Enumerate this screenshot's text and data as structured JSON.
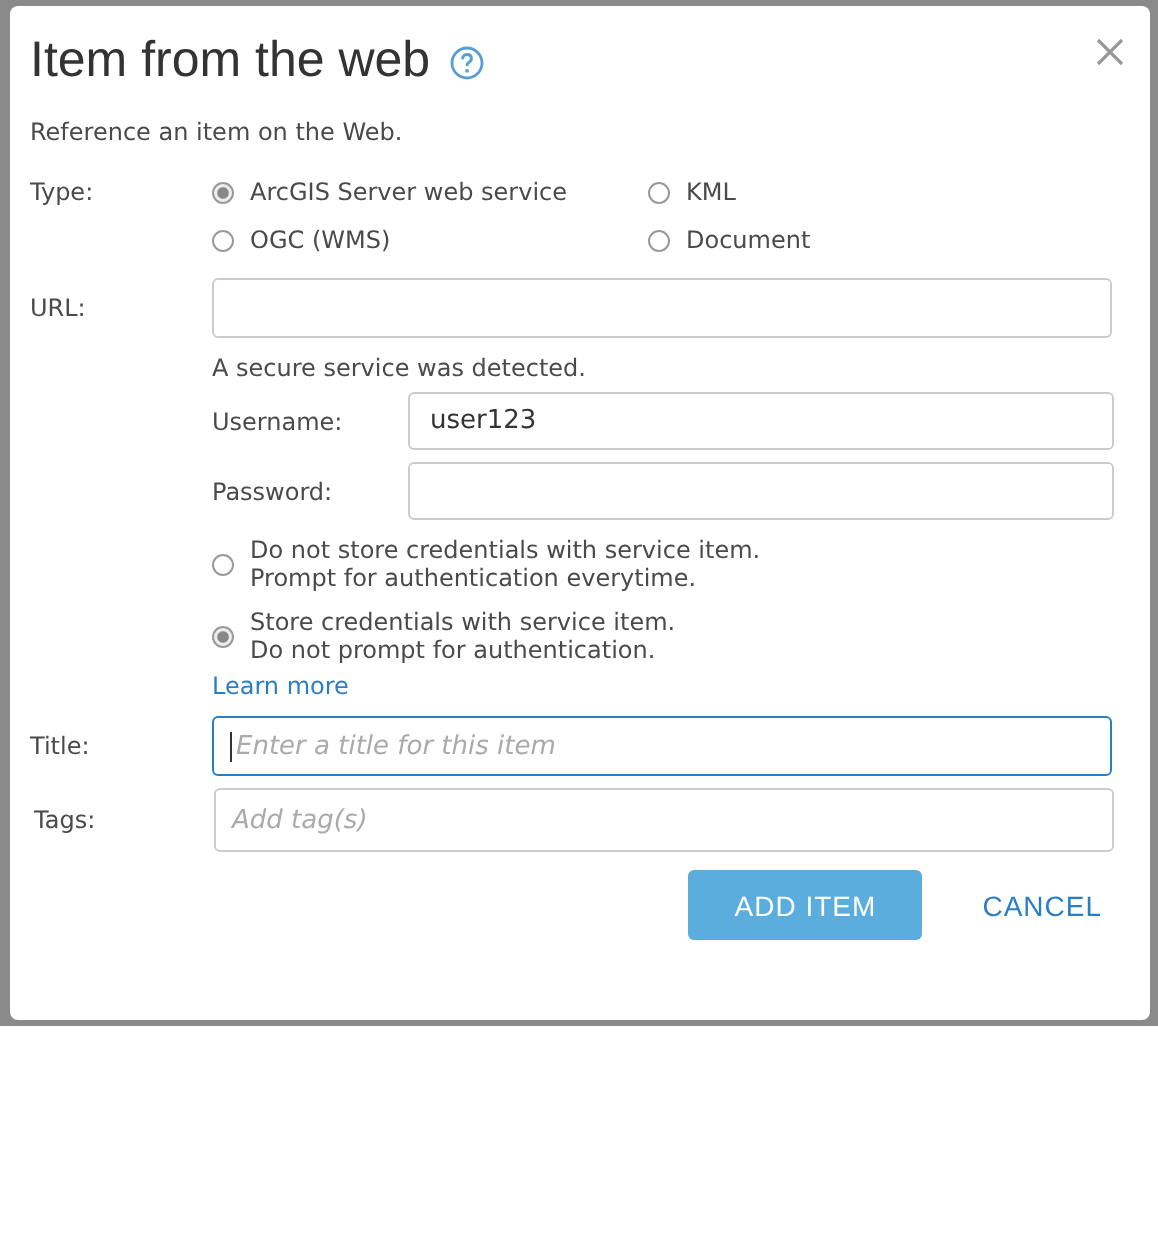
{
  "dialog": {
    "title": "Item from the web",
    "description": "Reference an item on the Web.",
    "type": {
      "label": "Type:",
      "options": [
        {
          "label": "ArcGIS Server web service",
          "selected": true
        },
        {
          "label": "KML",
          "selected": false
        },
        {
          "label": "OGC (WMS)",
          "selected": false
        },
        {
          "label": "Document",
          "selected": false
        }
      ]
    },
    "url": {
      "label": "URL:"
    },
    "secure_notice": "A secure service was detected.",
    "username": {
      "label": "Username:",
      "value": "user123"
    },
    "password": {
      "label": "Password:"
    },
    "credential_options": [
      {
        "lines": [
          "Do not store credentials with service item.",
          "Prompt for authentication everytime."
        ],
        "selected": false
      },
      {
        "lines": [
          "Store credentials with service item.",
          "Do not prompt for authentication."
        ],
        "selected": true
      }
    ],
    "learn_more": "Learn more",
    "title_field": {
      "label": "Title:",
      "placeholder": "Enter a title for this item",
      "focused": true
    },
    "tags_field": {
      "label": "Tags:",
      "placeholder": "Add tag(s)"
    },
    "buttons": [
      {
        "label": "ADD ITEM",
        "kind": "primary"
      },
      {
        "label": "CANCEL",
        "kind": "link"
      }
    ]
  }
}
